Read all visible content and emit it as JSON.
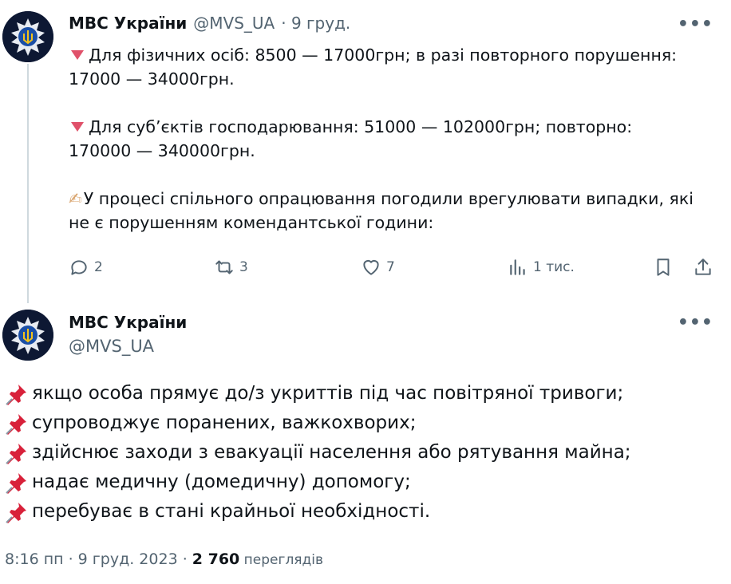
{
  "tweet1": {
    "author_name": "МВС України",
    "author_handle": "@MVS_UA",
    "date": "· 9 груд.",
    "more_label": "•••",
    "lines": {
      "l1": "Для фізичних осіб: 8500 — 17000грн; в разі повторного порушення:",
      "l2": "17000 — 34000грн.",
      "l3": "Для суб’єктів господарювання: 51000 — 102000грн; повторно:",
      "l4": "170000 — 340000грн.",
      "l5": "У процесі спільного опрацювання погодили врегулювати випадки, які",
      "l6": "не є порушенням комендантської години:"
    },
    "actions": {
      "replies": "2",
      "reposts": "3",
      "likes": "7",
      "views": "1 тис."
    },
    "icons": [
      "reply-icon",
      "repost-icon",
      "like-icon",
      "views-icon",
      "bookmark-icon",
      "share-icon"
    ]
  },
  "tweet2": {
    "author_name": "МВС України",
    "author_handle": "@MVS_UA",
    "more_label": "•••",
    "lines": [
      " якщо особа прямує до/з укриттів під час повітряної тривоги;",
      "супроводжує поранених, важкохворих;",
      " здійснює заходи з евакуації населення або рятування майна;",
      "надає медичну (домедичну) допомогу;",
      "перебуває в стані крайньої необхідності."
    ],
    "meta": {
      "time_date": "8:16 пп · 9 груд. 2023 · ",
      "views_count": "2 760",
      "views_label": " переглядів"
    }
  },
  "colors": {
    "text": "#0f1419",
    "secondary": "#536471",
    "triangle": "#e0516a",
    "pin": "#d8213a",
    "avatar_bg": "#0d1833"
  }
}
